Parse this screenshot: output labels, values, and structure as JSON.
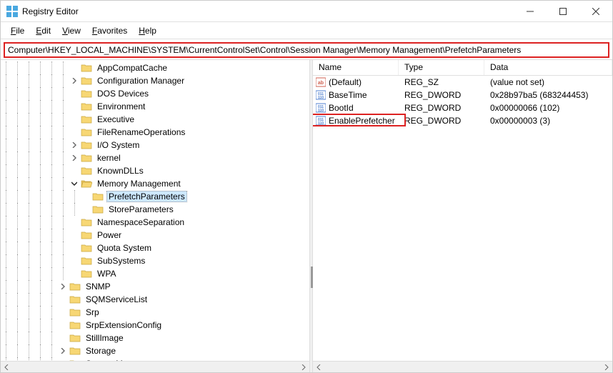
{
  "window": {
    "title": "Registry Editor"
  },
  "menu": {
    "file": "File",
    "edit": "Edit",
    "view": "View",
    "favorites": "Favorites",
    "help": "Help"
  },
  "address": "Computer\\HKEY_LOCAL_MACHINE\\SYSTEM\\CurrentControlSet\\Control\\Session Manager\\Memory Management\\PrefetchParameters",
  "tree": [
    {
      "depth": 6,
      "exp": "none",
      "label": "AppCompatCache"
    },
    {
      "depth": 6,
      "exp": "closed",
      "label": "Configuration Manager"
    },
    {
      "depth": 6,
      "exp": "none",
      "label": "DOS Devices"
    },
    {
      "depth": 6,
      "exp": "none",
      "label": "Environment"
    },
    {
      "depth": 6,
      "exp": "none",
      "label": "Executive"
    },
    {
      "depth": 6,
      "exp": "none",
      "label": "FileRenameOperations"
    },
    {
      "depth": 6,
      "exp": "closed",
      "label": "I/O System"
    },
    {
      "depth": 6,
      "exp": "closed",
      "label": "kernel"
    },
    {
      "depth": 6,
      "exp": "none",
      "label": "KnownDLLs"
    },
    {
      "depth": 6,
      "exp": "open",
      "label": "Memory Management"
    },
    {
      "depth": 7,
      "exp": "none",
      "label": "PrefetchParameters",
      "selected": true
    },
    {
      "depth": 7,
      "exp": "none",
      "label": "StoreParameters"
    },
    {
      "depth": 6,
      "exp": "none",
      "label": "NamespaceSeparation"
    },
    {
      "depth": 6,
      "exp": "none",
      "label": "Power"
    },
    {
      "depth": 6,
      "exp": "none",
      "label": "Quota System"
    },
    {
      "depth": 6,
      "exp": "none",
      "label": "SubSystems"
    },
    {
      "depth": 6,
      "exp": "none",
      "label": "WPA"
    },
    {
      "depth": 5,
      "exp": "closed",
      "label": "SNMP"
    },
    {
      "depth": 5,
      "exp": "none",
      "label": "SQMServiceList"
    },
    {
      "depth": 5,
      "exp": "none",
      "label": "Srp"
    },
    {
      "depth": 5,
      "exp": "none",
      "label": "SrpExtensionConfig"
    },
    {
      "depth": 5,
      "exp": "none",
      "label": "StillImage"
    },
    {
      "depth": 5,
      "exp": "closed",
      "label": "Storage"
    },
    {
      "depth": 5,
      "exp": "closed",
      "label": "StorageManagement"
    }
  ],
  "list": {
    "headers": {
      "name": "Name",
      "type": "Type",
      "data": "Data"
    },
    "rows": [
      {
        "icon": "sz",
        "name": "(Default)",
        "type": "REG_SZ",
        "data": "(value not set)"
      },
      {
        "icon": "dw",
        "name": "BaseTime",
        "type": "REG_DWORD",
        "data": "0x28b97ba5 (683244453)"
      },
      {
        "icon": "dw",
        "name": "BootId",
        "type": "REG_DWORD",
        "data": "0x00000066 (102)"
      },
      {
        "icon": "dw",
        "name": "EnablePrefetcher",
        "type": "REG_DWORD",
        "data": "0x00000003 (3)",
        "hl": true
      }
    ]
  }
}
